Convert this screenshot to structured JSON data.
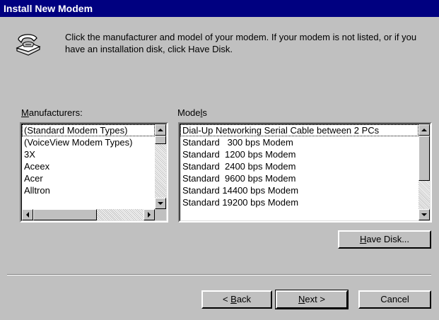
{
  "window": {
    "title": "Install New Modem"
  },
  "header": {
    "description": "Click the manufacturer and model of your modem. If your modem is not listed, or if you have an installation disk, click Have Disk."
  },
  "manufacturers": {
    "label_pre": "",
    "label_accel": "M",
    "label_post": "anufacturers:",
    "items": [
      "(Standard Modem Types)",
      "(VoiceView Modem Types)",
      "3X",
      "Aceex",
      "Acer",
      "Alltron"
    ],
    "selected_index": 0
  },
  "models": {
    "label_pre": "Mode",
    "label_accel": "l",
    "label_post": "s",
    "items": [
      "Dial-Up Networking Serial Cable between 2 PCs",
      "Standard   300 bps Modem",
      "Standard  1200 bps Modem",
      "Standard  2400 bps Modem",
      "Standard  9600 bps Modem",
      "Standard 14400 bps Modem",
      "Standard 19200 bps Modem"
    ],
    "selected_index": 0
  },
  "buttons": {
    "have_disk": {
      "accel": "H",
      "rest": "ave Disk..."
    },
    "back": {
      "pre": "< ",
      "accel": "B",
      "rest": "ack"
    },
    "next": {
      "accel": "N",
      "rest": "ext >"
    },
    "cancel": "Cancel"
  },
  "colors": {
    "titlebar": "#000080",
    "face": "#c0c0c0",
    "selection": "#000080"
  },
  "icons": {
    "header": "telephone-modem-icon"
  }
}
